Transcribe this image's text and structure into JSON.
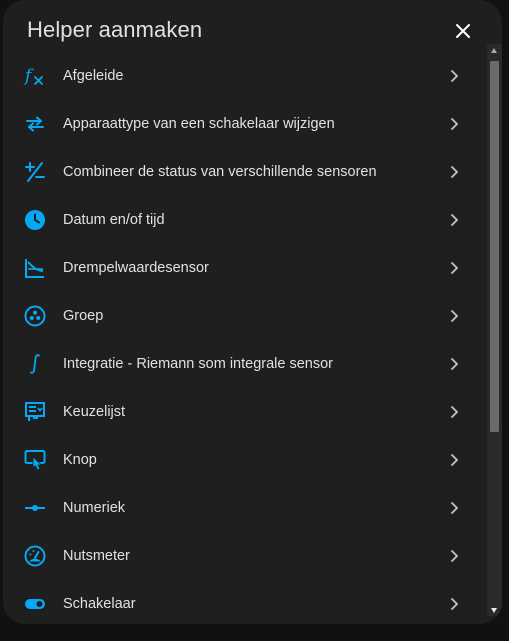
{
  "dialog": {
    "title": "Helper aanmaken",
    "close_icon": "close-icon",
    "accent_color": "#03a9f4"
  },
  "items": [
    {
      "label": "Afgeleide",
      "icon": "function-variant-icon"
    },
    {
      "label": "Apparaattype van een schakelaar wijzigen",
      "icon": "swap-horizontal-icon"
    },
    {
      "label": "Combineer de status van verschillende sensoren",
      "icon": "plus-minus-icon"
    },
    {
      "label": "Datum en/of tijd",
      "icon": "clock-icon"
    },
    {
      "label": "Drempelwaardesensor",
      "icon": "chart-threshold-icon"
    },
    {
      "label": "Groep",
      "icon": "group-icon"
    },
    {
      "label": "Integratie - Riemann som integrale sensor",
      "icon": "integral-icon"
    },
    {
      "label": "Keuzelijst",
      "icon": "form-select-icon"
    },
    {
      "label": "Knop",
      "icon": "gesture-tap-button-icon"
    },
    {
      "label": "Numeriek",
      "icon": "ray-vertex-icon"
    },
    {
      "label": "Nutsmeter",
      "icon": "gauge-icon"
    },
    {
      "label": "Schakelaar",
      "icon": "toggle-switch-icon"
    }
  ]
}
